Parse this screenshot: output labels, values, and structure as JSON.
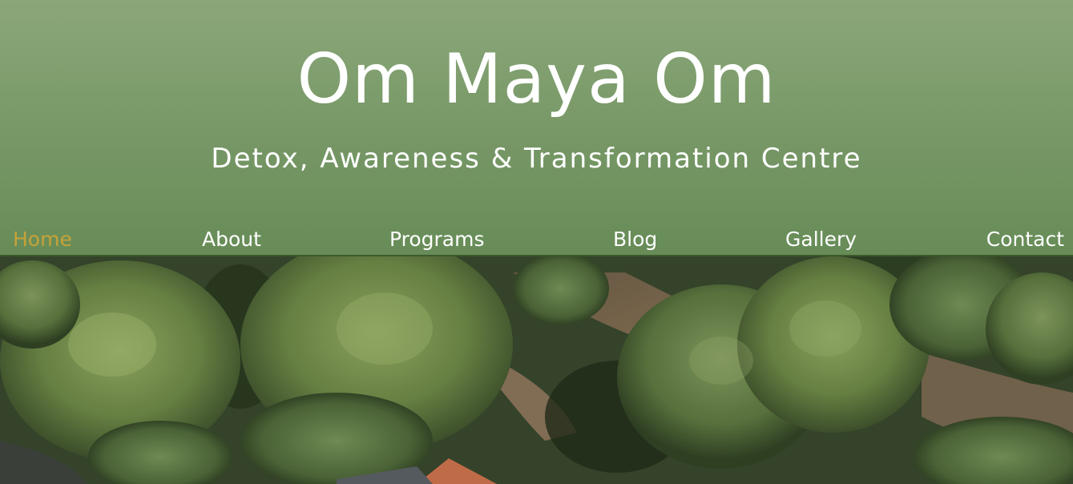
{
  "header": {
    "title": "Om Maya Om",
    "tagline": "Detox, Awareness & Transformation Centre"
  },
  "nav": {
    "items": [
      {
        "label": "Home",
        "active": true
      },
      {
        "label": "About",
        "active": false
      },
      {
        "label": "Programs",
        "active": false
      },
      {
        "label": "Blog",
        "active": false
      },
      {
        "label": "Gallery",
        "active": false
      },
      {
        "label": "Contact",
        "active": false
      }
    ],
    "active_color": "#c5a23a"
  },
  "hero": {
    "image": "aerial-forest-photo"
  },
  "colors": {
    "header_green": "#7a9a69",
    "text": "#ffffff"
  }
}
